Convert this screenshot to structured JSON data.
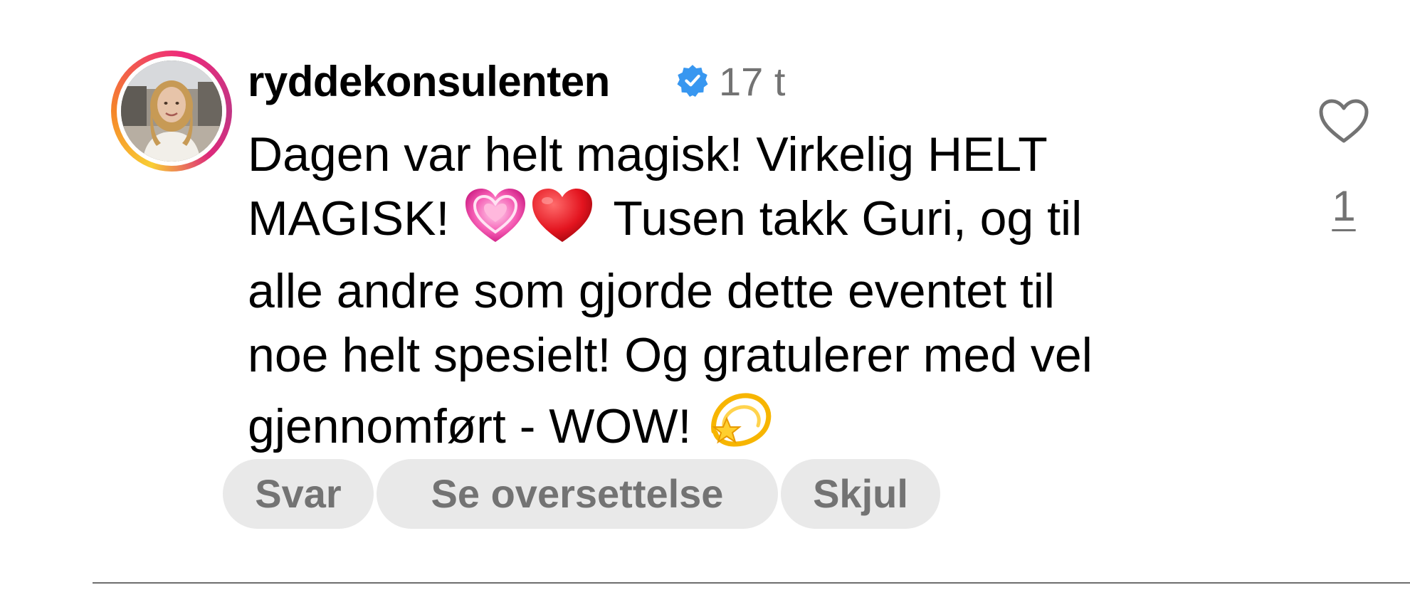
{
  "comment": {
    "username": "ryddekonsulenten",
    "verified": true,
    "timestamp": "17 t",
    "text_lines": [
      "Dagen var helt magisk! Virkelig HELT",
      "MAGISK!",
      "Tusen takk Guri, og til",
      "alle andre som gjorde dette eventet til",
      "noe helt spesielt! Og gratulerer med vel",
      "gjennomført - WOW!"
    ],
    "emojis": [
      "growing-heart-emoji",
      "red-heart-emoji",
      "dizzy-star-emoji"
    ]
  },
  "actions": {
    "reply_label": "Svar",
    "translate_label": "Se oversettelse",
    "hide_label": "Skjul"
  },
  "likes": {
    "count": "1",
    "icon": "heart-outline-icon"
  },
  "colors": {
    "verified_badge": "#3897f0",
    "secondary_text": "#737373",
    "pill_background": "#e9e9e9",
    "ring_gradient": [
      "#f9ce34",
      "#ee2a7b",
      "#c13584"
    ]
  }
}
